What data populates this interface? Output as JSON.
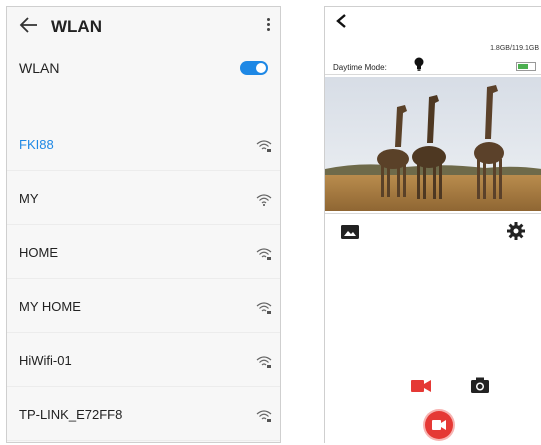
{
  "wlan": {
    "header_title": "WLAN",
    "toggle_label": "WLAN",
    "toggle_on": true,
    "accent_color": "#1e88e5",
    "networks": [
      {
        "ssid": "FKI88",
        "connected": true
      },
      {
        "ssid": "MY",
        "connected": false
      },
      {
        "ssid": "HOME",
        "connected": false
      },
      {
        "ssid": "MY HOME",
        "connected": false
      },
      {
        "ssid": "HiWifi-01",
        "connected": false
      },
      {
        "ssid": "TP-LINK_E72FF8",
        "connected": false
      }
    ],
    "icons": {
      "back": "back-arrow-icon",
      "more": "more-vert-icon",
      "signal": "wifi-lock-icon"
    }
  },
  "camera": {
    "storage": "1.8GB/119.1GB",
    "mode_label": "Daytime Mode:",
    "battery_level": 0.6,
    "record_color": "#e53935",
    "icons": {
      "back": "chevron-left-icon",
      "mode": "light-bulb-icon",
      "gallery": "gallery-icon",
      "settings": "gear-icon",
      "video": "video-camera-icon",
      "photo": "camera-icon",
      "record": "record-button-icon"
    }
  }
}
